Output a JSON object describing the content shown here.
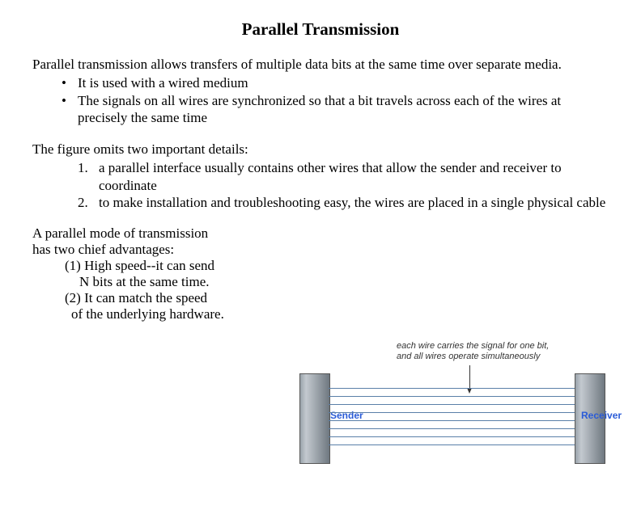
{
  "title": "Parallel Transmission",
  "intro": "Parallel transmission allows transfers of multiple data bits at the same time over separate media.",
  "bullets": [
    "It is used with a wired medium",
    "The signals on all wires are synchronized so that a bit travels across each of the wires at precisely the same time"
  ],
  "details_intro": "The figure omits two important details:",
  "details": [
    {
      "num": "1.",
      "text": "a parallel interface usually contains other wires that allow the sender and receiver to coordinate"
    },
    {
      "num": "2.",
      "text": "to make installation and troubleshooting easy, the wires are placed in a single physical cable"
    }
  ],
  "advantages": {
    "intro_line1": "A parallel mode of transmission",
    "intro_line2": "has two chief advantages:",
    "item1a": "(1) High speed--it can send",
    "item1b": "N bits at the same time.",
    "item2a": "(2) It can match the speed",
    "item2b": "of the underlying hardware."
  },
  "figure": {
    "caption_line1": "each wire carries the signal for one bit,",
    "caption_line2": "and all wires operate simultaneously",
    "sender": "Sender",
    "receiver": "Receiver"
  }
}
